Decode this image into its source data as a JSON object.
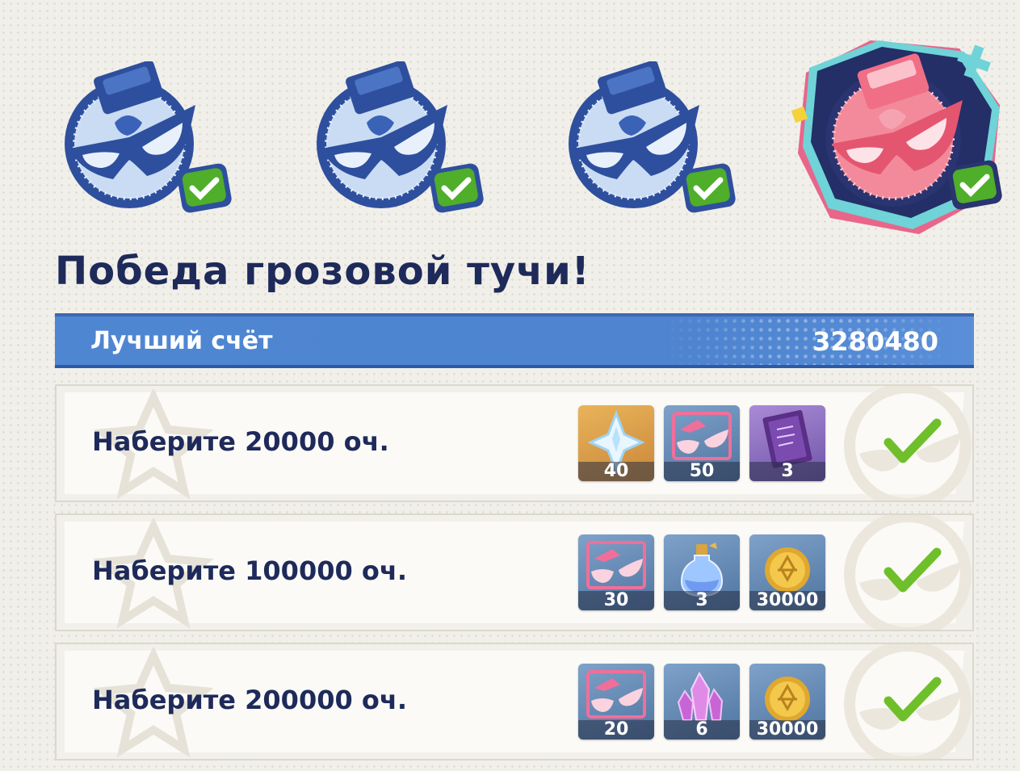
{
  "title": "Победа грозовой тучи!",
  "best_score": {
    "label": "Лучший счёт",
    "value": "3280480"
  },
  "badges": [
    {
      "icon": "mask-bomb-icon-blue",
      "completed": true
    },
    {
      "icon": "mask-bomb-icon-blue",
      "completed": true
    },
    {
      "icon": "mask-bomb-icon-blue",
      "completed": true
    },
    {
      "icon": "mask-bomb-icon-pink",
      "completed": true
    }
  ],
  "tasks": [
    {
      "text": "Наберите 20000 оч.",
      "completed": true,
      "rewards": [
        {
          "icon": "primogem-icon",
          "count": "40"
        },
        {
          "icon": "event-mask-token-icon",
          "count": "50"
        },
        {
          "icon": "purple-book-icon",
          "count": "3"
        }
      ]
    },
    {
      "text": "Наберите 100000 оч.",
      "completed": true,
      "rewards": [
        {
          "icon": "event-mask-token-icon",
          "count": "30"
        },
        {
          "icon": "potion-bottle-icon",
          "count": "3"
        },
        {
          "icon": "mora-coin-icon",
          "count": "30000"
        }
      ]
    },
    {
      "text": "Наберите 200000 оч.",
      "completed": true,
      "rewards": [
        {
          "icon": "event-mask-token-icon",
          "count": "20"
        },
        {
          "icon": "purple-crystal-icon",
          "count": "6"
        },
        {
          "icon": "mora-coin-icon",
          "count": "30000"
        }
      ]
    }
  ],
  "colors": {
    "navy": "#1e2a5a",
    "bar_blue": "#4e84d0",
    "check_green": "#6fbf2a",
    "pink_badge": "#f07a90"
  }
}
